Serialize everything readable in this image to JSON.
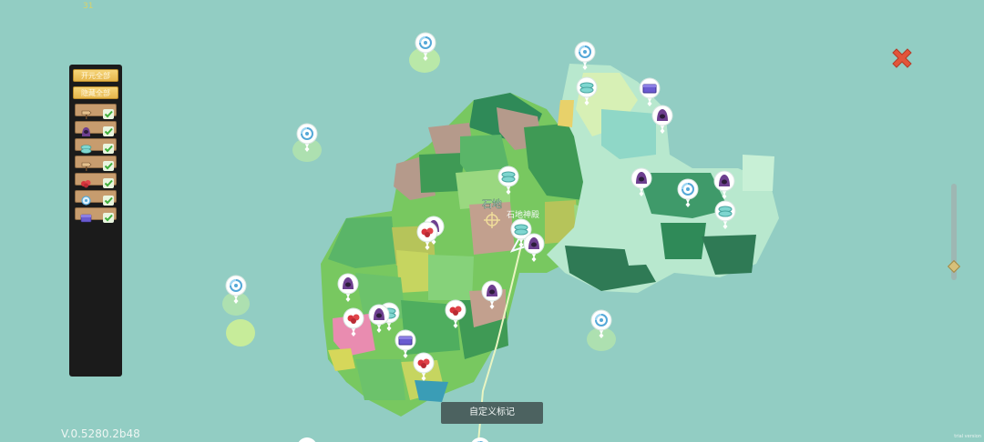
{
  "fps": "31",
  "version": "V.0.5280.2b48",
  "trial_text": "trial version",
  "filter_panel": {
    "show_all": "开元全部",
    "hide_all": "隐藏全部",
    "rows": [
      {
        "icon": "signpost-icon",
        "checked": true
      },
      {
        "icon": "hooded-figure-icon",
        "checked": true
      },
      {
        "icon": "teleporter-icon",
        "checked": true
      },
      {
        "icon": "signpost-icon",
        "checked": true
      },
      {
        "icon": "red-ore-icon",
        "checked": true
      },
      {
        "icon": "portal-swirl-icon",
        "checked": true
      },
      {
        "icon": "chest-icon",
        "checked": true
      }
    ]
  },
  "map": {
    "labels": {
      "region": "石地",
      "poi": "石地神殿"
    }
  },
  "custom_mark_button": "自定义标记",
  "colors": {
    "sea": "#92cdc3",
    "forest": "#7fcf72",
    "dark_forest": "#3f9f5a",
    "rock": "#c2a48e",
    "panel": "#1b1b1b",
    "close": "#e2553a"
  }
}
